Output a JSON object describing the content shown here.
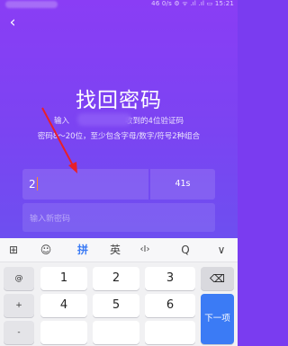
{
  "status_bar": {
    "text": "46 0/s ⚙ ᯤ .ıl .ıl ▭ 15:21"
  },
  "header": {
    "back_glyph": "‹",
    "title": "找回密码"
  },
  "hints": {
    "line1_prefix": "输入",
    "line1_suffix": "收到的4位验证码",
    "line2": "密码8～20位，至少包含字母/数字/符号2种组合"
  },
  "form": {
    "code_value": "2",
    "countdown": "41s",
    "password_placeholder": "输入新密码"
  },
  "keyboard": {
    "toolbar": {
      "grid_glyph": "⊞",
      "emoji_glyph": "☺",
      "pinyin_label": "拼",
      "english_label": "英",
      "cursor_glyph": "‹I›",
      "search_glyph": "Q",
      "collapse_glyph": "∨"
    },
    "side_keys": [
      "@",
      "+",
      "-"
    ],
    "row1": [
      "1",
      "2",
      "3"
    ],
    "row2": [
      "4",
      "5",
      "6"
    ],
    "backspace_glyph": "⌫",
    "next_label": "下一项"
  },
  "colors": {
    "accent": "#7b44f2",
    "keyboard_accent": "#3b7bf5",
    "arrow": "#e8202a"
  }
}
